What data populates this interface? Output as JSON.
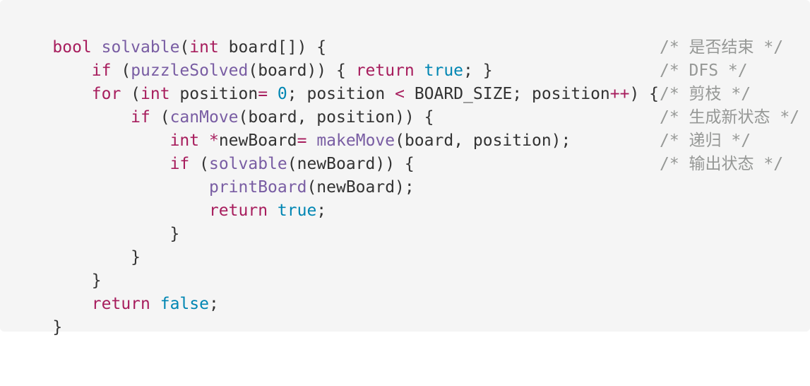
{
  "colors": {
    "background": "#f5f5f5",
    "keyword": "#a71d5d",
    "function": "#795da3",
    "constant": "#0086b3",
    "plain": "#333333",
    "comment": "#969896"
  },
  "code": {
    "language": "C",
    "lines": [
      {
        "tokens": [
          {
            "t": "bool",
            "k": "keyword"
          },
          {
            "t": " ",
            "k": "plain"
          },
          {
            "t": "solvable",
            "k": "func"
          },
          {
            "t": "(",
            "k": "plain"
          },
          {
            "t": "int",
            "k": "keyword"
          },
          {
            "t": " board[]) {",
            "k": "plain"
          }
        ],
        "comment": ""
      },
      {
        "tokens": [
          {
            "t": "    ",
            "k": "plain"
          },
          {
            "t": "if",
            "k": "keyword"
          },
          {
            "t": " (",
            "k": "plain"
          },
          {
            "t": "puzzleSolved",
            "k": "func"
          },
          {
            "t": "(board)) { ",
            "k": "plain"
          },
          {
            "t": "return",
            "k": "keyword"
          },
          {
            "t": " ",
            "k": "plain"
          },
          {
            "t": "true",
            "k": "const"
          },
          {
            "t": "; }",
            "k": "plain"
          }
        ],
        "comment": "/* 是否结束 */"
      },
      {
        "tokens": [
          {
            "t": "    ",
            "k": "plain"
          },
          {
            "t": "for",
            "k": "keyword"
          },
          {
            "t": " (",
            "k": "plain"
          },
          {
            "t": "int",
            "k": "keyword"
          },
          {
            "t": " position",
            "k": "plain"
          },
          {
            "t": "=",
            "k": "op"
          },
          {
            "t": " ",
            "k": "plain"
          },
          {
            "t": "0",
            "k": "const"
          },
          {
            "t": "; position ",
            "k": "plain"
          },
          {
            "t": "<",
            "k": "op"
          },
          {
            "t": " BOARD_SIZE; position",
            "k": "plain"
          },
          {
            "t": "++",
            "k": "op"
          },
          {
            "t": ") {",
            "k": "plain"
          }
        ],
        "comment": "/* DFS */"
      },
      {
        "tokens": [
          {
            "t": "        ",
            "k": "plain"
          },
          {
            "t": "if",
            "k": "keyword"
          },
          {
            "t": " (",
            "k": "plain"
          },
          {
            "t": "canMove",
            "k": "func"
          },
          {
            "t": "(board, position)) {",
            "k": "plain"
          }
        ],
        "comment": "/* 剪枝 */"
      },
      {
        "tokens": [
          {
            "t": "            ",
            "k": "plain"
          },
          {
            "t": "int",
            "k": "keyword"
          },
          {
            "t": " ",
            "k": "plain"
          },
          {
            "t": "*",
            "k": "op"
          },
          {
            "t": "newBoard",
            "k": "plain"
          },
          {
            "t": "=",
            "k": "op"
          },
          {
            "t": " ",
            "k": "plain"
          },
          {
            "t": "makeMove",
            "k": "func"
          },
          {
            "t": "(board, position);",
            "k": "plain"
          }
        ],
        "comment": "/* 生成新状态 */"
      },
      {
        "tokens": [
          {
            "t": "            ",
            "k": "plain"
          },
          {
            "t": "if",
            "k": "keyword"
          },
          {
            "t": " (",
            "k": "plain"
          },
          {
            "t": "solvable",
            "k": "func"
          },
          {
            "t": "(newBoard)) {",
            "k": "plain"
          }
        ],
        "comment": "/* 递归 */"
      },
      {
        "tokens": [
          {
            "t": "                ",
            "k": "plain"
          },
          {
            "t": "printBoard",
            "k": "func"
          },
          {
            "t": "(newBoard);",
            "k": "plain"
          }
        ],
        "comment": "/* 输出状态 */"
      },
      {
        "tokens": [
          {
            "t": "                ",
            "k": "plain"
          },
          {
            "t": "return",
            "k": "keyword"
          },
          {
            "t": " ",
            "k": "plain"
          },
          {
            "t": "true",
            "k": "const"
          },
          {
            "t": ";",
            "k": "plain"
          }
        ],
        "comment": ""
      },
      {
        "tokens": [
          {
            "t": "            }",
            "k": "plain"
          }
        ],
        "comment": ""
      },
      {
        "tokens": [
          {
            "t": "        }",
            "k": "plain"
          }
        ],
        "comment": ""
      },
      {
        "tokens": [
          {
            "t": "    }",
            "k": "plain"
          }
        ],
        "comment": ""
      },
      {
        "tokens": [
          {
            "t": "    ",
            "k": "plain"
          },
          {
            "t": "return",
            "k": "keyword"
          },
          {
            "t": " ",
            "k": "plain"
          },
          {
            "t": "false",
            "k": "const"
          },
          {
            "t": ";",
            "k": "plain"
          }
        ],
        "comment": ""
      },
      {
        "tokens": [
          {
            "t": "}",
            "k": "plain"
          }
        ],
        "comment": ""
      }
    ]
  }
}
